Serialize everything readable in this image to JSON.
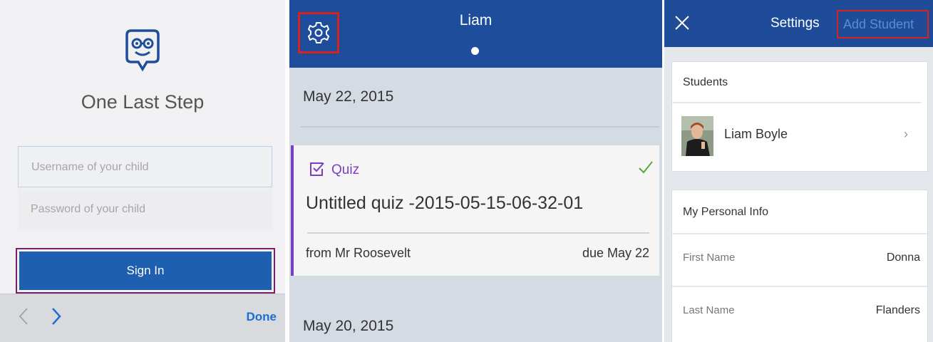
{
  "login": {
    "title": "One Last Step",
    "username_placeholder": "Username of your child",
    "password_placeholder": "Password of your child",
    "signin_label": "Sign In",
    "keyboard_done": "Done"
  },
  "stream": {
    "student_name": "Liam",
    "date1": "May 22, 2015",
    "date2": "May 20, 2015",
    "card": {
      "type_label": "Quiz",
      "title": "Untitled quiz -2015-05-15-06-32-01",
      "from": "from Mr Roosevelt",
      "due": "due May 22"
    }
  },
  "settings": {
    "title": "Settings",
    "add_student": "Add Student",
    "students_heading": "Students",
    "student_name": "Liam  Boyle",
    "chevron": "›",
    "personal_heading": "My Personal Info",
    "rows": [
      {
        "label": "First Name",
        "value": "Donna"
      },
      {
        "label": "Last Name",
        "value": "Flanders"
      }
    ]
  },
  "colors": {
    "brand_blue": "#1e4d9c",
    "highlight_red": "#d8221f",
    "highlight_purple": "#7b1f6b",
    "quiz_purple": "#7a3ec4",
    "check_green": "#5aa83b"
  },
  "icons": [
    "edmodo-logo-icon",
    "gear-icon",
    "quiz-check-icon",
    "checkmark-icon",
    "close-icon",
    "chevron-left-icon",
    "chevron-right-icon"
  ]
}
